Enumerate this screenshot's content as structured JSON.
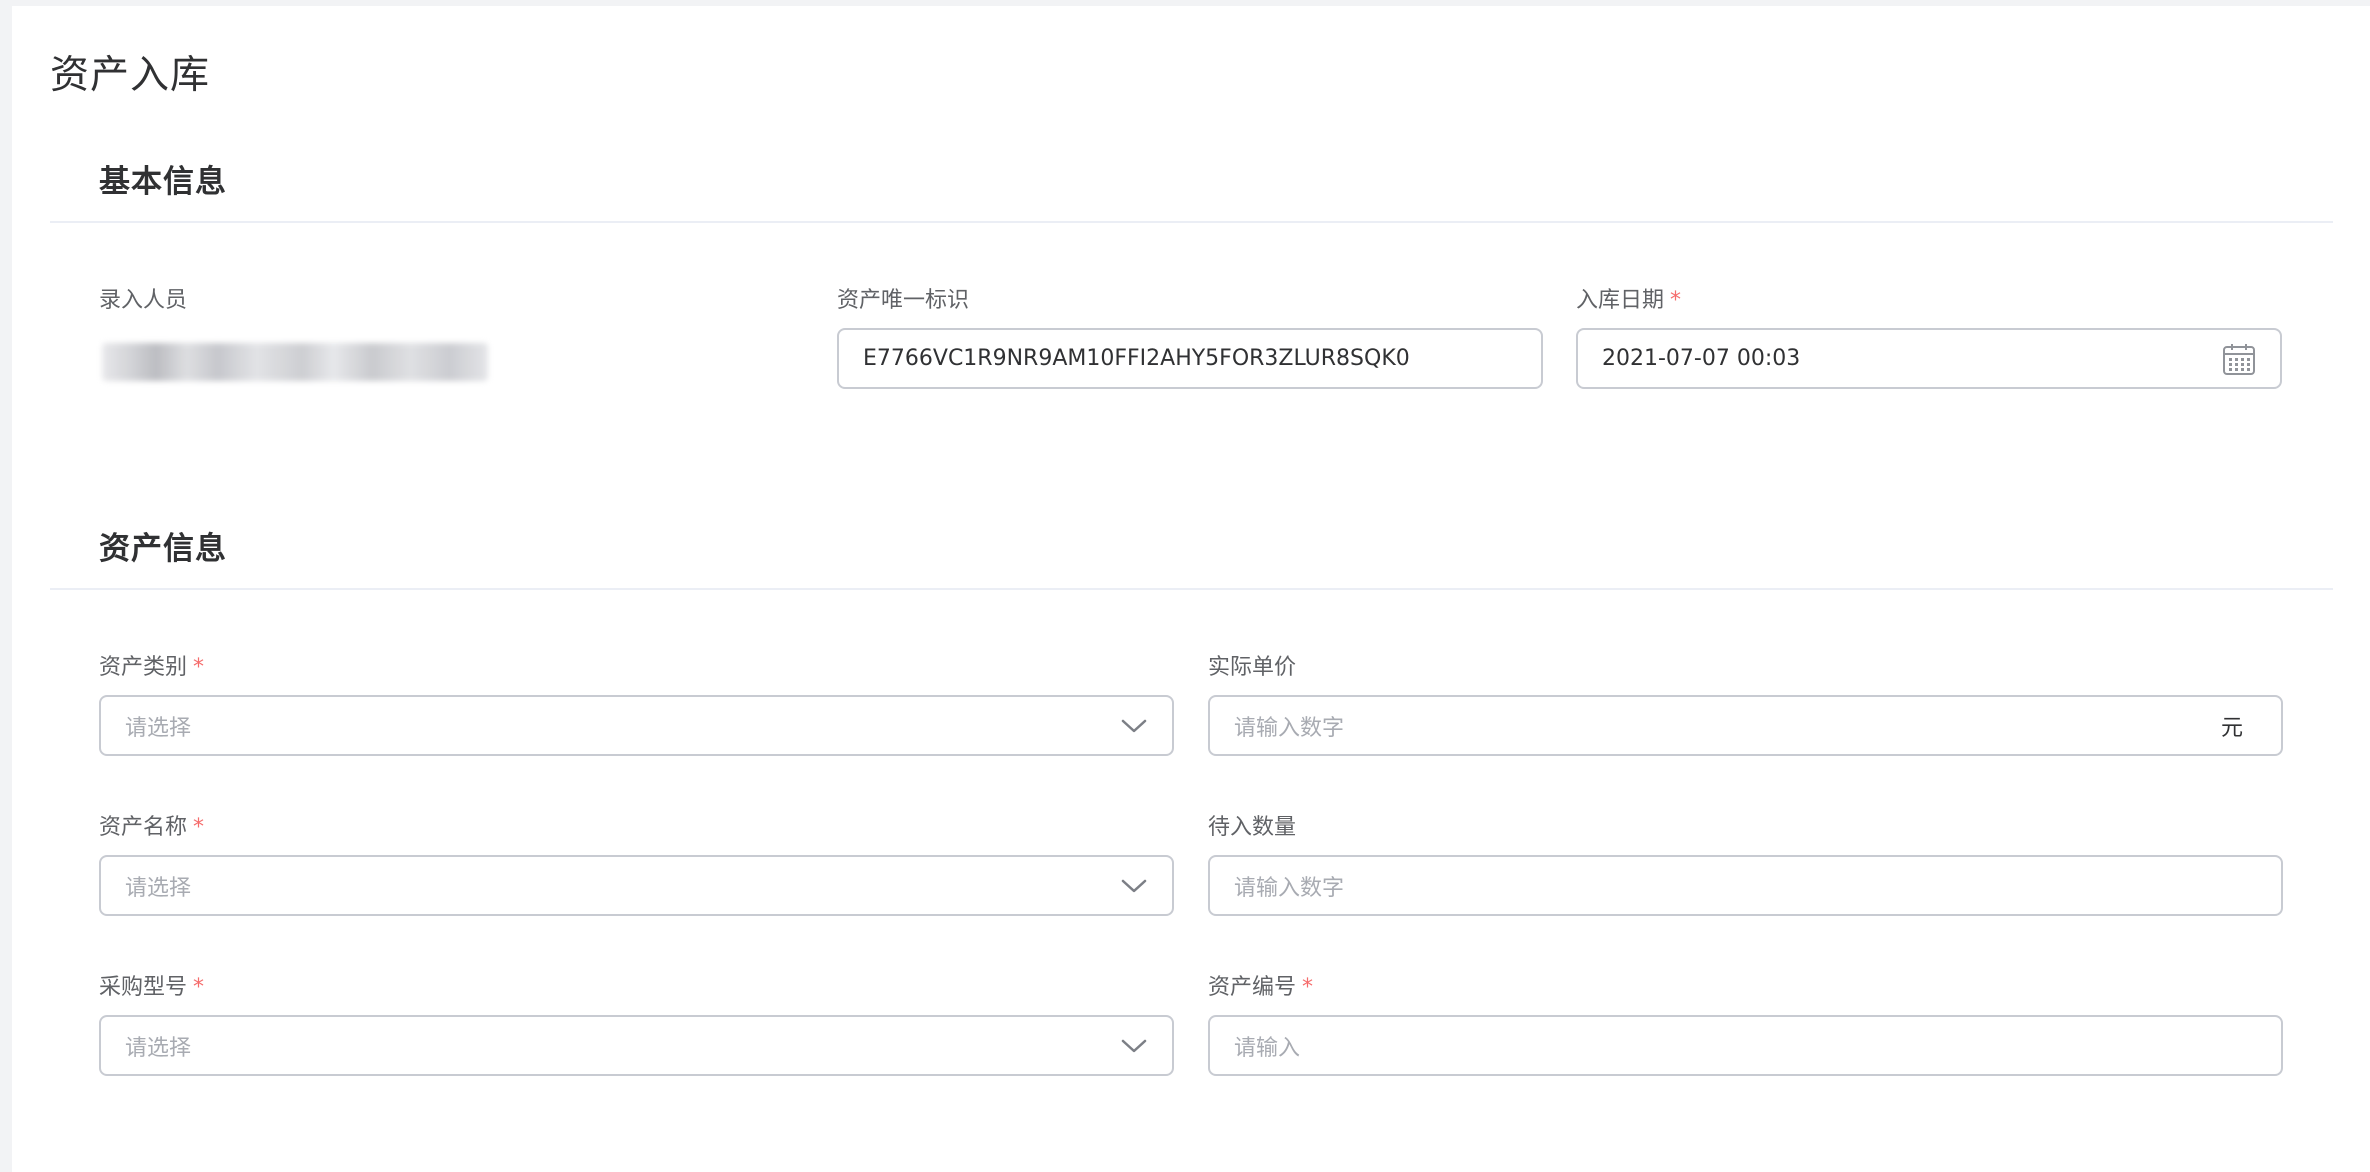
{
  "page": {
    "title": "资产入库"
  },
  "basic_info": {
    "section_title": "基本信息",
    "entry_person": {
      "label": "录入人员"
    },
    "asset_uid": {
      "label": "资产唯一标识",
      "value": "E7766VC1R9NR9AM10FFI2AHY5FOR3ZLUR8SQK0"
    },
    "entry_date": {
      "label": "入库日期",
      "required_mark": "*",
      "value": "2021-07-07 00:03",
      "icon": "calendar-icon"
    }
  },
  "asset_info": {
    "section_title": "资产信息",
    "asset_category": {
      "label": "资产类别",
      "required_mark": "*",
      "placeholder": "请选择",
      "icon": "chevron-down-icon"
    },
    "actual_unit_price": {
      "label": "实际单价",
      "placeholder": "请输入数字",
      "suffix": "元"
    },
    "asset_name": {
      "label": "资产名称",
      "required_mark": "*",
      "placeholder": "请选择",
      "icon": "chevron-down-icon"
    },
    "pending_quantity": {
      "label": "待入数量",
      "placeholder": "请输入数字"
    },
    "purchase_model": {
      "label": "采购型号",
      "required_mark": "*",
      "placeholder": "请选择",
      "icon": "chevron-down-icon"
    },
    "asset_number": {
      "label": "资产编号",
      "required_mark": "*",
      "placeholder": "请输入"
    }
  },
  "colors": {
    "required": "#f56c6c",
    "border": "#c8cbd2",
    "placeholder": "#a8abb2",
    "divider": "#ebeef5"
  }
}
